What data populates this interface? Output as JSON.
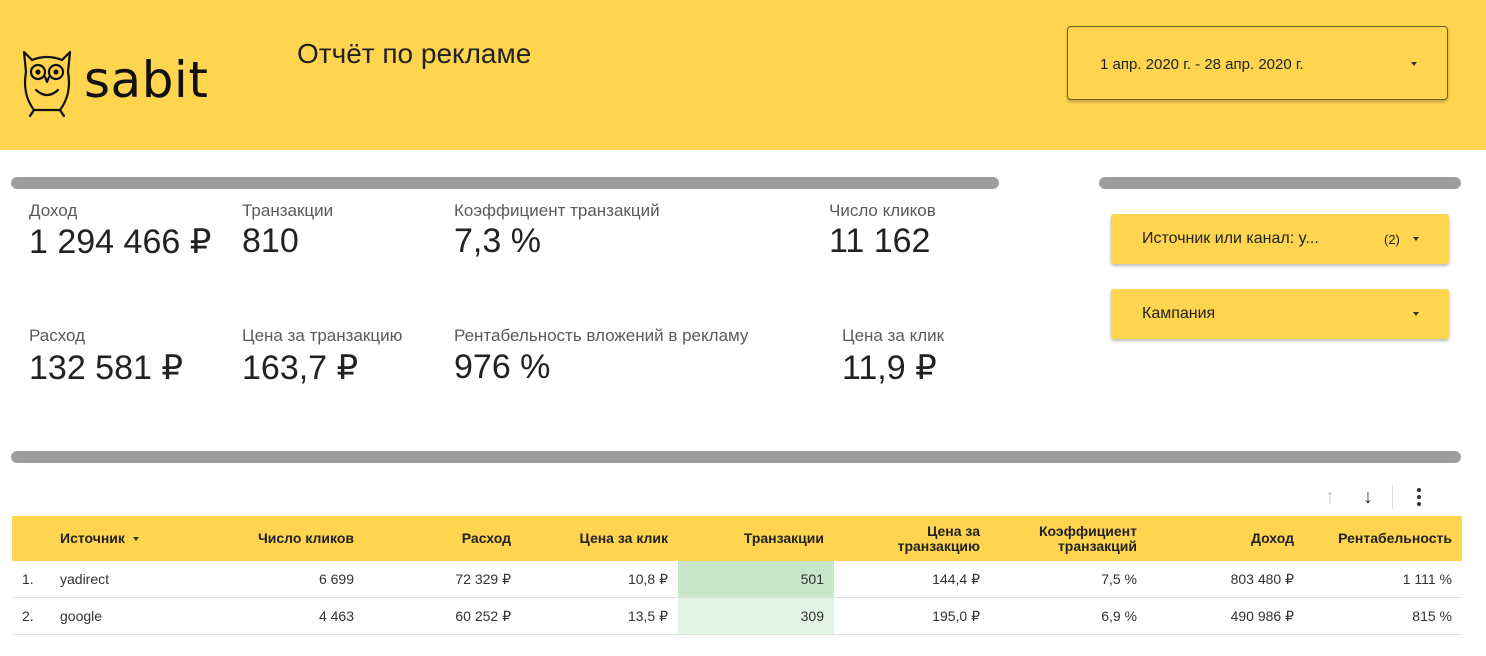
{
  "header": {
    "brand": "sabit",
    "title": "Отчёт по рекламе",
    "date_range": "1 апр. 2020 г. - 28 апр. 2020 г.",
    "bg_color": "#ffd54f"
  },
  "kpis": {
    "revenue": {
      "label": "Доход",
      "value": "1 294 466 ₽"
    },
    "transactions": {
      "label": "Транзакции",
      "value": "810"
    },
    "conversion": {
      "label": "Коэффициент транзакций",
      "value": "7,3 %"
    },
    "clicks": {
      "label": "Число кликов",
      "value": "11 162"
    },
    "cost": {
      "label": "Расход",
      "value": "132 581 ₽"
    },
    "cost_per_transaction": {
      "label": "Цена за транзакцию",
      "value": "163,7 ₽"
    },
    "roas": {
      "label": "Рентабельность вложений в рекламу",
      "value": "976 %"
    },
    "cpc": {
      "label": "Цена за клик",
      "value": "11,9 ₽"
    }
  },
  "filters": {
    "source": {
      "label": "Источник или канал: y...",
      "count": "(2)"
    },
    "campaign": {
      "label": "Кампания"
    }
  },
  "table": {
    "columns": [
      "Источник",
      "Число кликов",
      "Расход",
      "Цена за клик",
      "Транзакции",
      "Цена за транзакцию",
      "Коэффициент транзакций",
      "Доход",
      "Рентабельность"
    ],
    "rows": [
      {
        "index": "1.",
        "source": "yadirect",
        "clicks": "6 699",
        "cost": "72 329 ₽",
        "cpc": "10,8 ₽",
        "transactions": "501",
        "cpt": "144,4 ₽",
        "conv": "7,5 %",
        "revenue": "803 480 ₽",
        "roas": "1 111 %",
        "heat_color": "#c8e6c9"
      },
      {
        "index": "2.",
        "source": "google",
        "clicks": "4 463",
        "cost": "60 252 ₽",
        "cpc": "13,5 ₽",
        "transactions": "309",
        "cpt": "195,0 ₽",
        "conv": "6,9 %",
        "revenue": "490 986 ₽",
        "roas": "815 %",
        "heat_color": "#e1f3e1"
      }
    ]
  }
}
